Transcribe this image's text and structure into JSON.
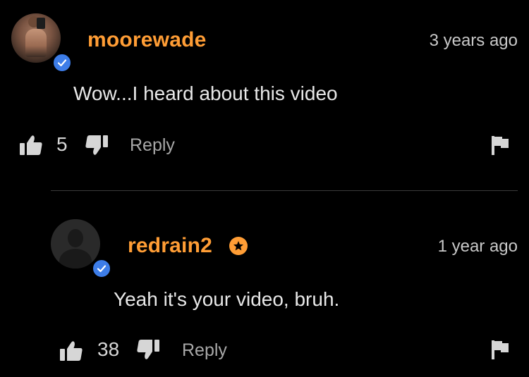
{
  "comments": [
    {
      "username": "moorewade",
      "time": "3 years ago",
      "text": "Wow...I heard about this video",
      "likes": "5",
      "reply_label": "Reply",
      "verified": true
    },
    {
      "username": "redrain2",
      "time": "1 year ago",
      "text": "Yeah it's your video, bruh.",
      "likes": "38",
      "reply_label": "Reply",
      "verified": true,
      "badge": "star"
    }
  ],
  "colors": {
    "background": "#000000",
    "username": "#ff9d35",
    "verified": "#3d7de8",
    "text": "#e8e8e8",
    "muted": "#a8a8a8"
  },
  "icons": [
    "verified-check-icon",
    "star-badge-icon",
    "thumbs-up-icon",
    "thumbs-down-icon",
    "flag-icon"
  ]
}
